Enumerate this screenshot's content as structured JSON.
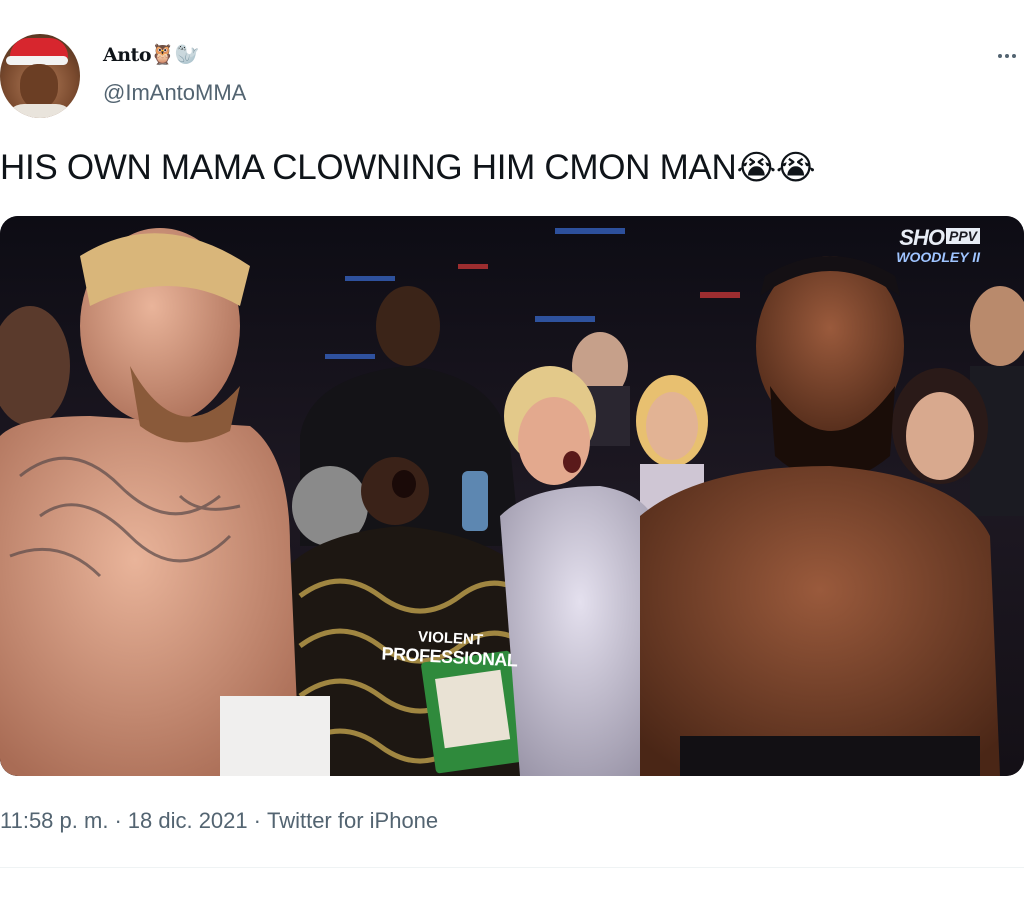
{
  "author": {
    "display_name": "Anto",
    "name_emojis": "🦉🦭",
    "handle": "@ImAntoMMA",
    "avatar_icon": "santa-hat-avatar"
  },
  "tweet": {
    "text": "HIS OWN MAMA CLOWNING HIM CMON MAN",
    "text_emojis": "😭😭"
  },
  "media": {
    "broadcast_logo": "SHO",
    "broadcast_badge": "PPV",
    "broadcast_sub": "WOODLEY II",
    "shirt_line1": "VIOLENT",
    "shirt_line2": "PROFESSIONAL"
  },
  "meta": {
    "time": "11:58 p. m.",
    "date": "18 dic. 2021",
    "separator": "·",
    "source": "Twitter for iPhone"
  },
  "colors": {
    "text_primary": "#0f1419",
    "text_secondary": "#536471",
    "divider": "#eff3f4"
  }
}
